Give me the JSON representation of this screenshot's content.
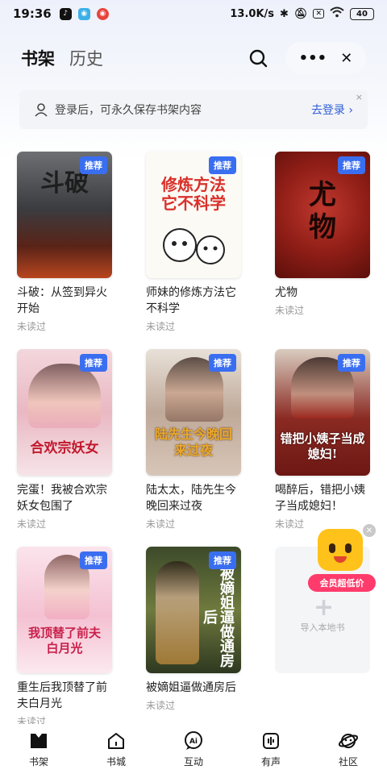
{
  "status_bar": {
    "time": "19:36",
    "network_speed": "13.0K/s",
    "battery": "40"
  },
  "header": {
    "tab_bookshelf": "书架",
    "tab_history": "历史"
  },
  "login_bar": {
    "text": "登录后，可永久保存书架内容",
    "link": "去登录 ›",
    "close": "×"
  },
  "badge_label": "推荐",
  "books": [
    {
      "title": "斗破：从签到异火开始",
      "status": "未读过",
      "cover_text": "斗破"
    },
    {
      "title": "师妹的修炼方法它不科学",
      "status": "未读过",
      "cover_text": "修炼方法它不科学"
    },
    {
      "title": "尤物",
      "status": "未读过",
      "cover_text": "尤物"
    },
    {
      "title": "完蛋！我被合欢宗妖女包围了",
      "status": "未读过",
      "cover_text": "合欢宗妖女"
    },
    {
      "title": "陆太太，陆先生今晚回来过夜",
      "status": "未读过",
      "cover_text": "陆先生今晚回来过夜"
    },
    {
      "title": "喝醉后，错把小姨子当成媳妇！",
      "status": "未读过",
      "cover_text": "错把小姨子当成媳妇!"
    },
    {
      "title": "重生后我顶替了前夫白月光",
      "status": "未读过",
      "cover_text": "我顶替了前夫白月光"
    },
    {
      "title": "被嫡姐逼做通房后",
      "status": "未读过",
      "cover_text": "被嫡姐逼做通房后"
    }
  ],
  "import_local": {
    "label": "导入本地书"
  },
  "promo": {
    "label": "会员超低价"
  },
  "bottom_nav": [
    {
      "label": "书架",
      "icon": "bookshelf-icon"
    },
    {
      "label": "书城",
      "icon": "bookstore-icon"
    },
    {
      "label": "互动",
      "icon": "ai-chat-icon"
    },
    {
      "label": "有声",
      "icon": "audio-icon"
    },
    {
      "label": "社区",
      "icon": "community-icon"
    }
  ],
  "colors": {
    "accent": "#3a6ef0",
    "link": "#2f5fd6",
    "promo": "#ff3b6b"
  }
}
